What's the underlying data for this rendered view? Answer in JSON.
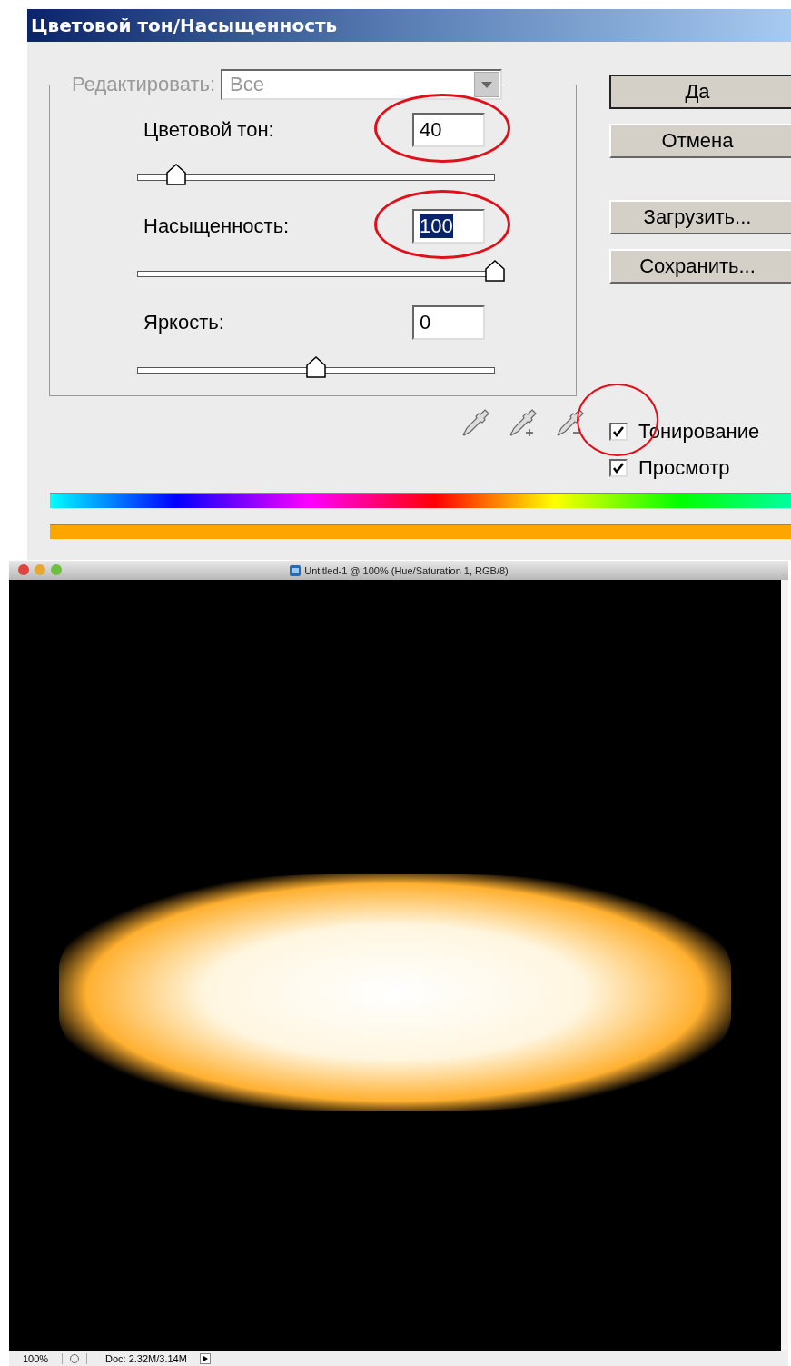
{
  "dialog": {
    "title": "Цветовой тон/Насыщенность",
    "edit": {
      "label": "Редактировать:",
      "value": "Все",
      "disabled": true
    },
    "adjustments": [
      {
        "label": "Цветовой тон:",
        "value": "40",
        "level": 0.11,
        "highlighted": true,
        "text_selected": false
      },
      {
        "label": "Насыщенность:",
        "value": "100",
        "level": 1,
        "highlighted": true,
        "text_selected": true
      },
      {
        "label": "Яркость:",
        "value": "0",
        "level": 0.5,
        "highlighted": false,
        "text_selected": false
      }
    ],
    "buttons": [
      {
        "label": "Да",
        "default": true
      },
      {
        "label": "Отмена",
        "default": false
      },
      {
        "label": "Загрузить...",
        "default": false
      },
      {
        "label": "Сохранить...",
        "default": false
      }
    ],
    "options": [
      {
        "label": "Тонирование",
        "checked": true,
        "highlighted": true
      },
      {
        "label": "Просмотр",
        "checked": true,
        "highlighted": false
      }
    ]
  },
  "document": {
    "title": "Untitled-1 @ 100% (Hue/Saturation 1, RGB/8)",
    "zoom": "100%",
    "doc_info": "Doc: 2.32M/3.14M"
  }
}
